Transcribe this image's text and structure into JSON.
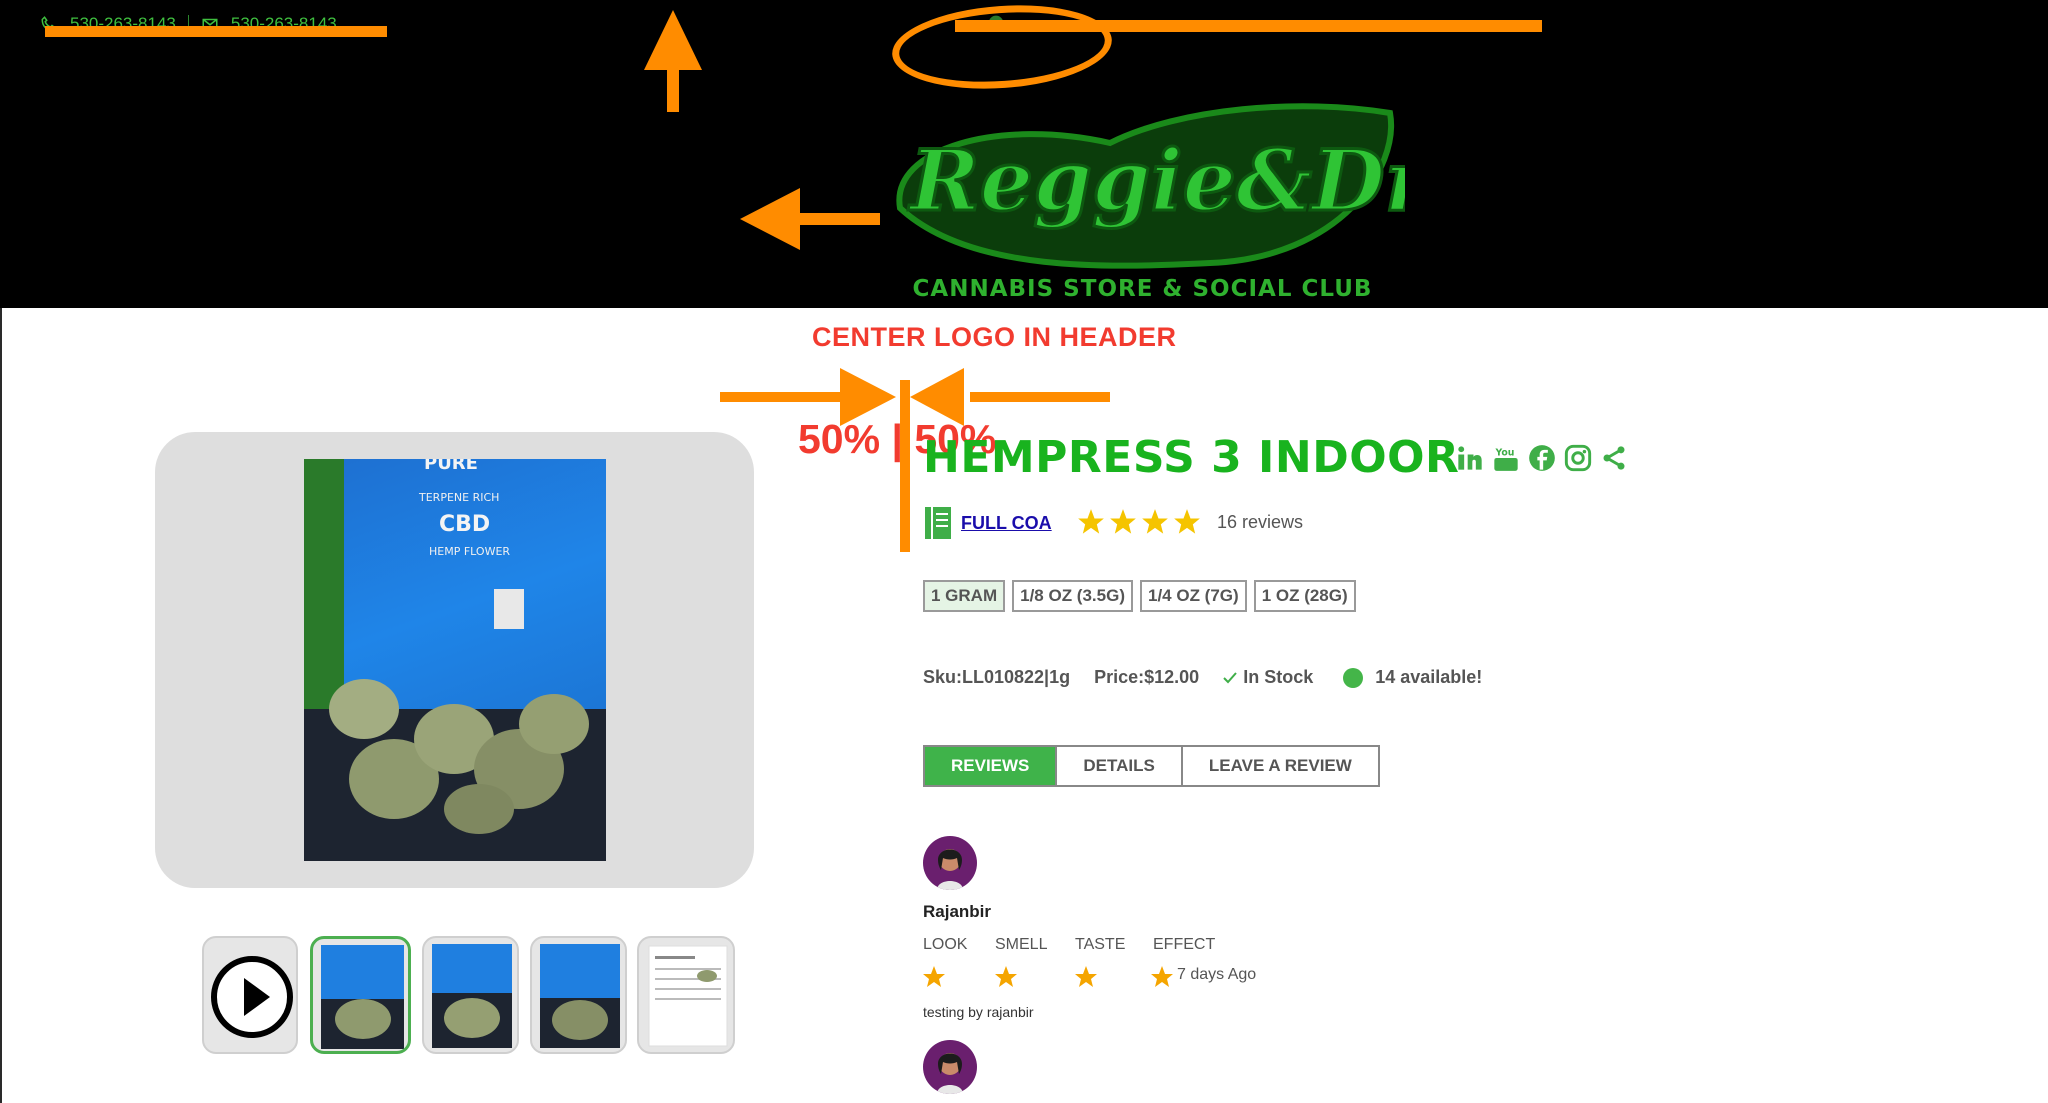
{
  "header": {
    "phone": "530-263-8143",
    "email": "530-263-8143",
    "brand_name": "Reggie&Dro",
    "brand_tagline": "CANNABIS STORE & SOCIAL CLUB"
  },
  "annotations": {
    "center_note": "CENTER LOGO IN HEADER",
    "split_note": "50% | 50%"
  },
  "product": {
    "title": "HEMPRESS 3 INDOOR",
    "coa_label": "FULL COA",
    "rating_stars": 4,
    "reviews_count": "16 reviews",
    "sizes": [
      "1 GRAM",
      "1/8 OZ (3.5G)",
      "1/4 OZ (7G)",
      "1 OZ (28G)"
    ],
    "selected_size": "1 GRAM",
    "sku": "Sku:LL010822|1g",
    "price": "Price:$12.00",
    "stock": "In Stock",
    "available": "14 available!",
    "package_text": {
      "line1": "PURE",
      "line2": "TERPENE RICH",
      "line3": "CBD",
      "line4": "HEMP FLOWER"
    }
  },
  "tabs": [
    "REVIEWS",
    "DETAILS",
    "LEAVE A REVIEW"
  ],
  "reviews": [
    {
      "name": "Rajanbir",
      "categories": [
        "LOOK",
        "SMELL",
        "TASTE",
        "EFFECT"
      ],
      "time_ago": "7 days Ago",
      "text": "testing by rajanbir"
    }
  ],
  "colors": {
    "brand_green": "#19b31e",
    "annotation_orange": "#ff8c00",
    "annotation_red": "#f23b2f",
    "star_yellow": "#f5c400"
  }
}
